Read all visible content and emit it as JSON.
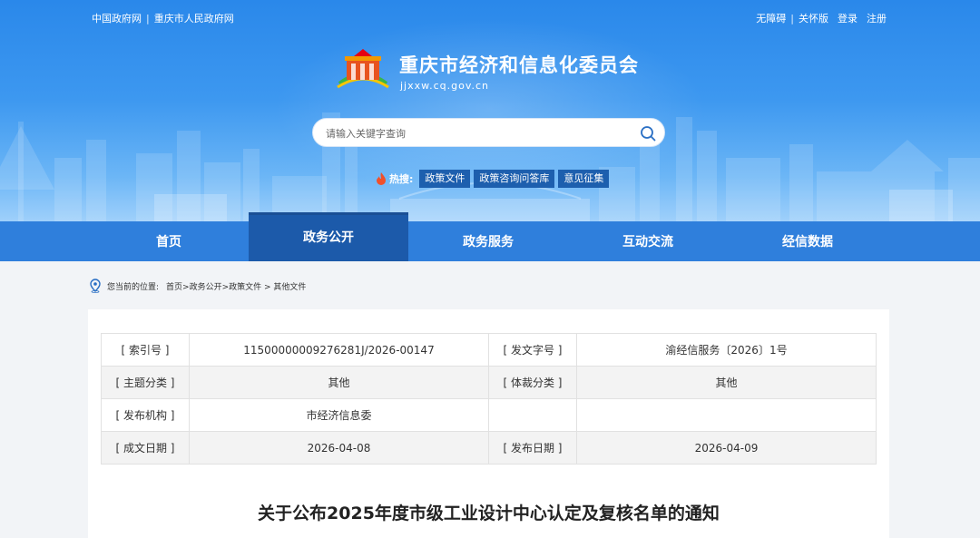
{
  "header": {
    "top_left_links": [
      "中国政府网",
      "重庆市人民政府网"
    ],
    "top_right_links": [
      "无障碍",
      "关怀版",
      "登录",
      "注册"
    ],
    "site_title": "重庆市经济和信息化委员会",
    "site_domain": "jjxxw.cq.gov.cn",
    "search": {
      "placeholder": "请输入关键字查询"
    },
    "hot_label": "热搜:",
    "hot_tags": [
      "政策文件",
      "政策咨询问答库",
      "意见征集"
    ]
  },
  "nav": {
    "items": [
      "首页",
      "政务公开",
      "政务服务",
      "互动交流",
      "经信数据"
    ],
    "active": "政务公开"
  },
  "breadcrumb": {
    "label": "您当前的位置:",
    "path": "首页>政务公开>政策文件 > 其他文件"
  },
  "meta_table": {
    "rows": [
      [
        "[ 索引号 ]",
        "11500000009276281J/2026-00147",
        "[ 发文字号 ]",
        "渝经信服务〔2026〕1号"
      ],
      [
        "[ 主题分类 ]",
        "其他",
        "[ 体裁分类 ]",
        "其他"
      ],
      [
        "[ 发布机构 ]",
        "市经济信息委",
        "",
        ""
      ],
      [
        "[ 成文日期 ]",
        "2026-04-08",
        "[ 发布日期 ]",
        "2026-04-09"
      ]
    ]
  },
  "document": {
    "title": "关于公布2025年度市级工业设计中心认定及复核名单的通知"
  },
  "colors": {
    "banner_blue": "#2a88ea",
    "nav_blue": "#2f7fdc",
    "nav_active": "#1c5aaa",
    "hot_tag_bg": "#1d5fae"
  }
}
